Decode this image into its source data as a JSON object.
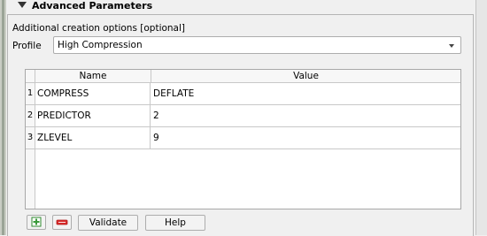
{
  "section": {
    "title": "Advanced Parameters"
  },
  "creation_options": {
    "label": "Additional creation options [optional]",
    "profile_label": "Profile",
    "profile_value": "High Compression"
  },
  "table": {
    "headers": {
      "name": "Name",
      "value": "Value"
    },
    "rows": [
      {
        "num": "1",
        "name": "COMPRESS",
        "value": "DEFLATE"
      },
      {
        "num": "2",
        "name": "PREDICTOR",
        "value": "2"
      },
      {
        "num": "3",
        "name": "ZLEVEL",
        "value": "9"
      }
    ]
  },
  "buttons": {
    "add_icon": "plus-icon",
    "remove_icon": "minus-icon",
    "validate": "Validate",
    "help": "Help"
  },
  "colors": {
    "add_icon": "#3a9a3a",
    "remove_icon": "#d92b2b"
  }
}
